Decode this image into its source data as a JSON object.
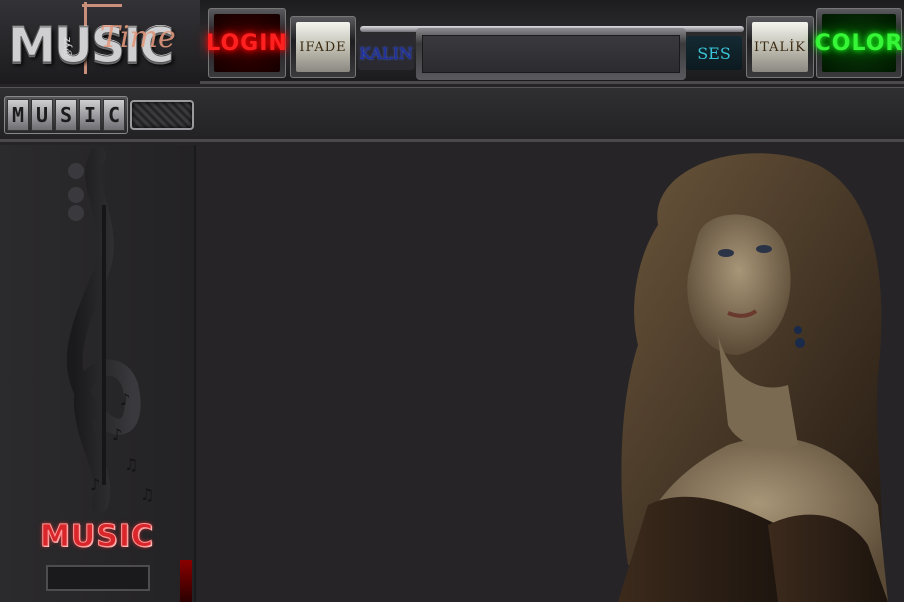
{
  "logo": {
    "text": "MUSIC",
    "script": "Time",
    "at": "@yz"
  },
  "toolbar": {
    "login_label": "LOGIN",
    "ifade_label": "IFADE",
    "kalin_label": "KALIN",
    "message_value": "",
    "ses_label": "SES",
    "italik_label": "ITALİK",
    "color_label": "COLOR"
  },
  "secondbar": {
    "music_letters": [
      "M",
      "U",
      "S",
      "I",
      "C"
    ]
  },
  "sidebar": {
    "title": "MUSIC"
  },
  "colors": {
    "login": "#ff2020",
    "color_btn": "#37f537",
    "kalin": "#1c2f9c",
    "ses": "#39c3d6",
    "sidebar_title": "#d8262a"
  }
}
